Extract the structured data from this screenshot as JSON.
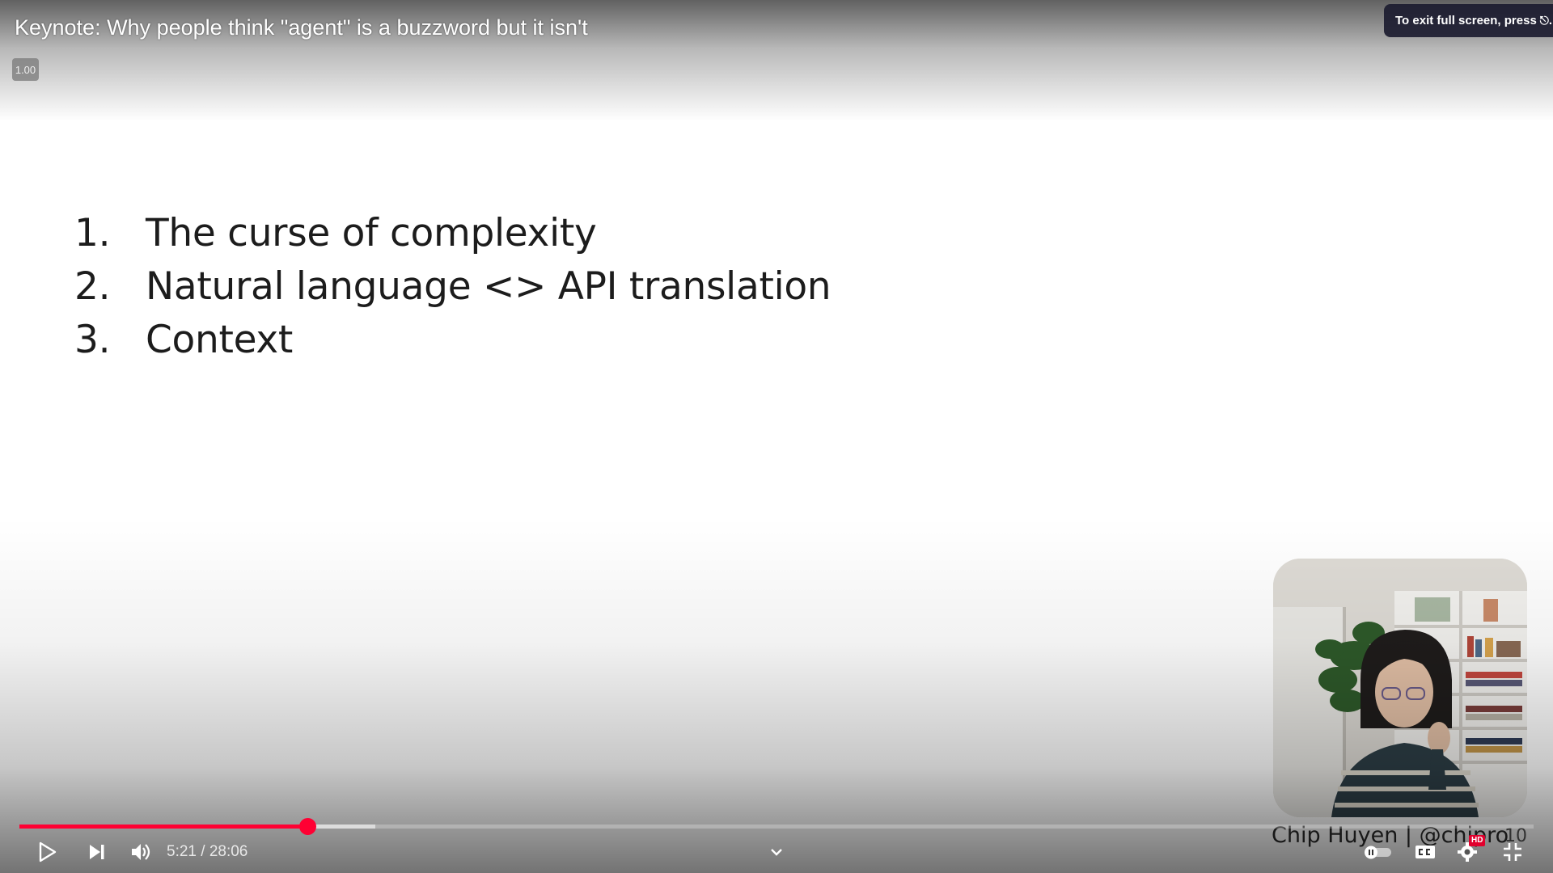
{
  "player": {
    "title": "Keynote: Why people think \"agent\" is a buzzword but it isn't",
    "speed_badge": "1.00",
    "fullscreen_toast": "To exit full screen, press",
    "fullscreen_key_icon": "escape-key-icon"
  },
  "slide": {
    "items": [
      {
        "number": "1.",
        "text": "The curse of complexity"
      },
      {
        "number": "2.",
        "text": "Natural language <> API translation"
      },
      {
        "number": "3.",
        "text": "Context"
      }
    ],
    "speaker_caption": "Chip Huyen | @chipro",
    "page_number": "10"
  },
  "progress": {
    "played_fraction": 0.19,
    "buffered_fraction": 0.19,
    "accent_color": "#ff0033"
  },
  "controls": {
    "current_time": "5:21",
    "duration": "28:06",
    "time_separator": " / ",
    "time_text": "5:21 / 28:06",
    "hd_badge": "HD",
    "icons": [
      "play-icon",
      "next-icon",
      "volume-icon",
      "chevron-down-icon",
      "autoplay-toggle-icon",
      "captions-icon",
      "settings-icon",
      "exit-fullscreen-icon"
    ]
  }
}
